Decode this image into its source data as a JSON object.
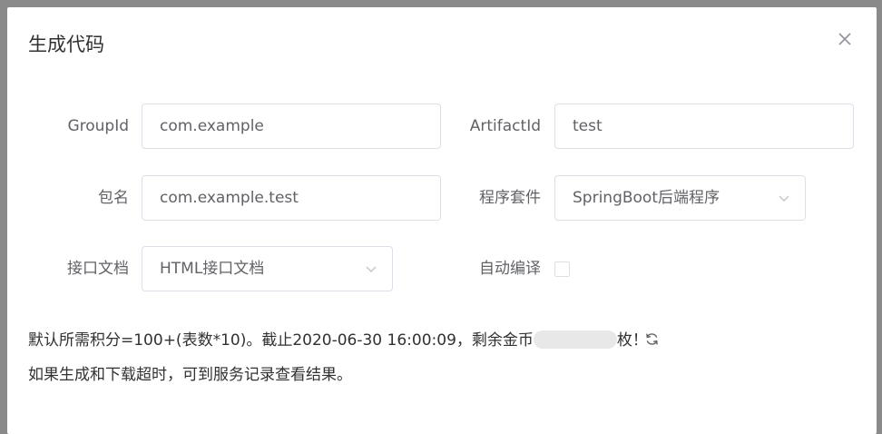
{
  "dialog": {
    "title": "生成代码",
    "close_icon": "close-icon"
  },
  "form": {
    "group_id": {
      "label": "GroupId",
      "value": "com.example"
    },
    "artifact_id": {
      "label": "ArtifactId",
      "value": "test"
    },
    "package": {
      "label": "包名",
      "value": "com.example.test"
    },
    "suite": {
      "label": "程序套件",
      "value": "SpringBoot后端程序"
    },
    "api_doc": {
      "label": "接口文档",
      "value": "HTML接口文档"
    },
    "auto_compile": {
      "label": "自动编译",
      "checked": false
    }
  },
  "notes": {
    "points_prefix": "默认所需积分=100+(表数*10)。截止2020-06-30 16:00:09，剩余金币",
    "points_suffix": "枚！",
    "timeout_hint": "如果生成和下载超时，可到服务记录查看结果。"
  },
  "colors": {
    "border": "#dcdfe6",
    "label": "#606266",
    "text": "#303133"
  }
}
